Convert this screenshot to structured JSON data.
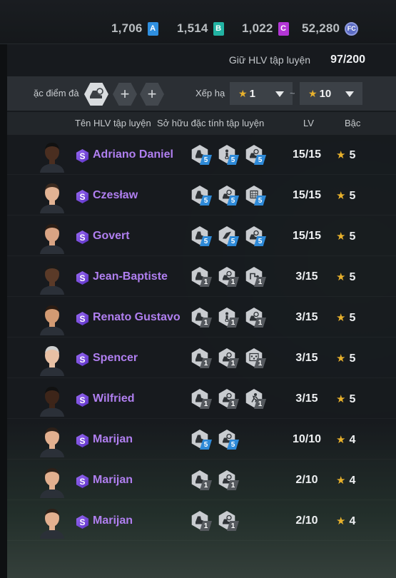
{
  "currencies": [
    {
      "amount": "1,706",
      "badge": "A",
      "color": "#2f8fe0"
    },
    {
      "amount": "1,514",
      "badge": "B",
      "color": "#22b3a3"
    },
    {
      "amount": "1,022",
      "badge": "C",
      "color": "#b436d6"
    },
    {
      "amount": "52,280",
      "badge": "FC",
      "color": "#6070c8"
    }
  ],
  "capacity": {
    "label": "Giữ HLV tập luyện",
    "value": "97/200"
  },
  "filter": {
    "label": "ặc điểm đà",
    "rank_label": "Xếp hạ",
    "min_rank": "1",
    "separator": "~",
    "max_rank": "10"
  },
  "columns": {
    "name": "Tên HLV tập luyện",
    "traits": "Sở hữu đặc tính tập luyện",
    "level": "LV",
    "rank": "Bậc"
  },
  "coaches": [
    {
      "badge": "S",
      "name": "Adriano Daniel",
      "level": "15/15",
      "rank": "5",
      "skin": "#4a2e20",
      "hair": "#111",
      "traits": [
        {
          "icon": "boot-icon",
          "lv": "5",
          "color": "blue"
        },
        {
          "icon": "player-ball-icon",
          "lv": "5",
          "color": "blue"
        },
        {
          "icon": "cleat-ball-icon",
          "lv": "5",
          "color": "blue"
        }
      ]
    },
    {
      "badge": "S",
      "name": "Czesław",
      "level": "15/15",
      "rank": "5",
      "skin": "#e2b394",
      "hair": "#3b2a1f",
      "traits": [
        {
          "icon": "boot-icon",
          "lv": "5",
          "color": "blue"
        },
        {
          "icon": "cleat-ball-icon",
          "lv": "5",
          "color": "blue"
        },
        {
          "icon": "net-ball-icon",
          "lv": "5",
          "color": "blue"
        }
      ]
    },
    {
      "badge": "S",
      "name": "Govert",
      "level": "15/15",
      "rank": "5",
      "skin": "#d9a484",
      "hair": "#2b1d14",
      "traits": [
        {
          "icon": "boot-icon",
          "lv": "5",
          "color": "blue"
        },
        {
          "icon": "kick-icon",
          "lv": "5",
          "color": "blue"
        },
        {
          "icon": "cleat-ball-icon",
          "lv": "5",
          "color": "blue"
        }
      ]
    },
    {
      "badge": "S",
      "name": "Jean-Baptiste",
      "level": "3/15",
      "rank": "5",
      "skin": "#5a3a28",
      "hair": "#1a1a1a",
      "traits": [
        {
          "icon": "boot-icon",
          "lv": "1",
          "color": "gray"
        },
        {
          "icon": "cleat-ball-icon",
          "lv": "1",
          "color": "gray"
        },
        {
          "icon": "tactic-icon",
          "lv": "1",
          "color": "gray"
        }
      ]
    },
    {
      "badge": "S",
      "name": "Renato Gustavo",
      "level": "3/15",
      "rank": "5",
      "skin": "#d29a73",
      "hair": "#2a1b12",
      "traits": [
        {
          "icon": "boot-icon",
          "lv": "1",
          "color": "gray"
        },
        {
          "icon": "player-ball-icon",
          "lv": "1",
          "color": "gray"
        },
        {
          "icon": "cleat-ball-icon",
          "lv": "1",
          "color": "gray"
        }
      ]
    },
    {
      "badge": "S",
      "name": "Spencer",
      "level": "3/15",
      "rank": "5",
      "skin": "#e8c0a4",
      "hair": "#cfcfcf",
      "traits": [
        {
          "icon": "boot-icon",
          "lv": "1",
          "color": "gray"
        },
        {
          "icon": "cleat-ball-icon",
          "lv": "1",
          "color": "gray"
        },
        {
          "icon": "formation-icon",
          "lv": "1",
          "color": "gray"
        }
      ]
    },
    {
      "badge": "S",
      "name": "Wilfried",
      "level": "3/15",
      "rank": "5",
      "skin": "#3d2519",
      "hair": "#111",
      "traits": [
        {
          "icon": "boot-icon",
          "lv": "1",
          "color": "gray"
        },
        {
          "icon": "cleat-ball-icon",
          "lv": "1",
          "color": "gray"
        },
        {
          "icon": "runner-icon",
          "lv": "1",
          "color": "gray"
        }
      ]
    },
    {
      "badge": "S",
      "name": "Marijan",
      "level": "10/10",
      "rank": "4",
      "skin": "#e3b08f",
      "hair": "#2d2018",
      "traits": [
        {
          "icon": "boot-icon",
          "lv": "5",
          "color": "blue"
        },
        {
          "icon": "cleat-ball-icon",
          "lv": "5",
          "color": "blue"
        }
      ]
    },
    {
      "badge": "S",
      "name": "Marijan",
      "level": "2/10",
      "rank": "4",
      "skin": "#e3b08f",
      "hair": "#2d2018",
      "traits": [
        {
          "icon": "boot-icon",
          "lv": "1",
          "color": "gray"
        },
        {
          "icon": "cleat-ball-icon",
          "lv": "1",
          "color": "gray"
        }
      ]
    },
    {
      "badge": "S",
      "name": "Marijan",
      "level": "2/10",
      "rank": "4",
      "skin": "#e3b08f",
      "hair": "#2d2018",
      "traits": [
        {
          "icon": "boot-icon",
          "lv": "1",
          "color": "gray"
        },
        {
          "icon": "cleat-ball-icon",
          "lv": "1",
          "color": "gray"
        }
      ]
    }
  ]
}
